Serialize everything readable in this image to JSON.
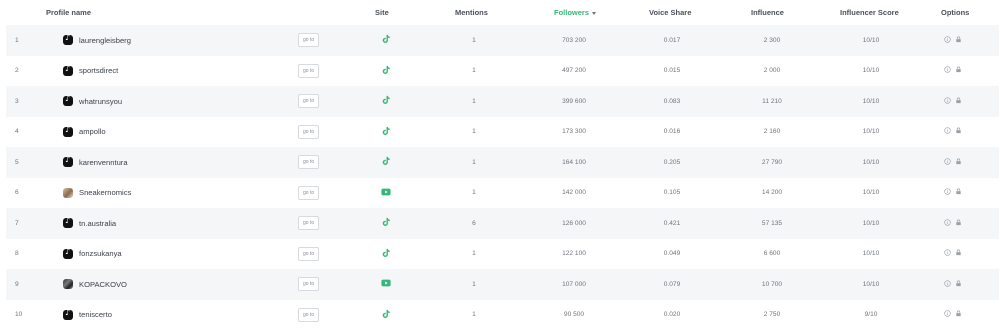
{
  "table": {
    "headers": {
      "profile": "Profile name",
      "site": "Site",
      "mentions": "Mentions",
      "followers": "Followers",
      "voice_share": "Voice Share",
      "influence": "Influence",
      "score": "Influencer Score",
      "options": "Options"
    },
    "sorted_column": "followers",
    "goto_label": "go to",
    "colors": {
      "accent": "#35b779",
      "youtube": "#35b779",
      "row_stripe": "#f5f6f8"
    },
    "rows": [
      {
        "num": "1",
        "name": "laurengleisberg",
        "avatar": "tiktok",
        "site": "tiktok-icon",
        "mentions": "1",
        "followers": "703 200",
        "voice_share": "0.017",
        "influence": "2 300",
        "score": "10/10"
      },
      {
        "num": "2",
        "name": "sportsdirect",
        "avatar": "tiktok",
        "site": "tiktok-icon",
        "mentions": "1",
        "followers": "497 200",
        "voice_share": "0.015",
        "influence": "2 000",
        "score": "10/10"
      },
      {
        "num": "3",
        "name": "whatrunsyou",
        "avatar": "tiktok",
        "site": "tiktok-icon",
        "mentions": "1",
        "followers": "399 600",
        "voice_share": "0.083",
        "influence": "11 210",
        "score": "10/10"
      },
      {
        "num": "4",
        "name": "ampollo",
        "avatar": "tiktok",
        "site": "tiktok-icon",
        "mentions": "1",
        "followers": "173 300",
        "voice_share": "0.016",
        "influence": "2 160",
        "score": "10/10"
      },
      {
        "num": "5",
        "name": "karenvenntura",
        "avatar": "tiktok",
        "site": "tiktok-icon",
        "mentions": "1",
        "followers": "164 100",
        "voice_share": "0.205",
        "influence": "27 790",
        "score": "10/10"
      },
      {
        "num": "6",
        "name": "Sneakernomics",
        "avatar": "photo1",
        "site": "youtube-icon",
        "mentions": "1",
        "followers": "142 000",
        "voice_share": "0.105",
        "influence": "14 200",
        "score": "10/10"
      },
      {
        "num": "7",
        "name": "tn.australia",
        "avatar": "tiktok",
        "site": "tiktok-icon",
        "mentions": "6",
        "followers": "126 000",
        "voice_share": "0.421",
        "influence": "57 135",
        "score": "10/10"
      },
      {
        "num": "8",
        "name": "fonzsukanya",
        "avatar": "tiktok",
        "site": "tiktok-icon",
        "mentions": "1",
        "followers": "122 100",
        "voice_share": "0.049",
        "influence": "6 600",
        "score": "10/10"
      },
      {
        "num": "9",
        "name": "KOPACKOVO",
        "avatar": "photo2",
        "site": "youtube-icon",
        "mentions": "1",
        "followers": "107 000",
        "voice_share": "0.079",
        "influence": "10 700",
        "score": "10/10"
      },
      {
        "num": "10",
        "name": "teniscerto",
        "avatar": "tiktok",
        "site": "tiktok-icon",
        "mentions": "1",
        "followers": "90 500",
        "voice_share": "0.020",
        "influence": "2 750",
        "score": "9/10"
      }
    ]
  }
}
